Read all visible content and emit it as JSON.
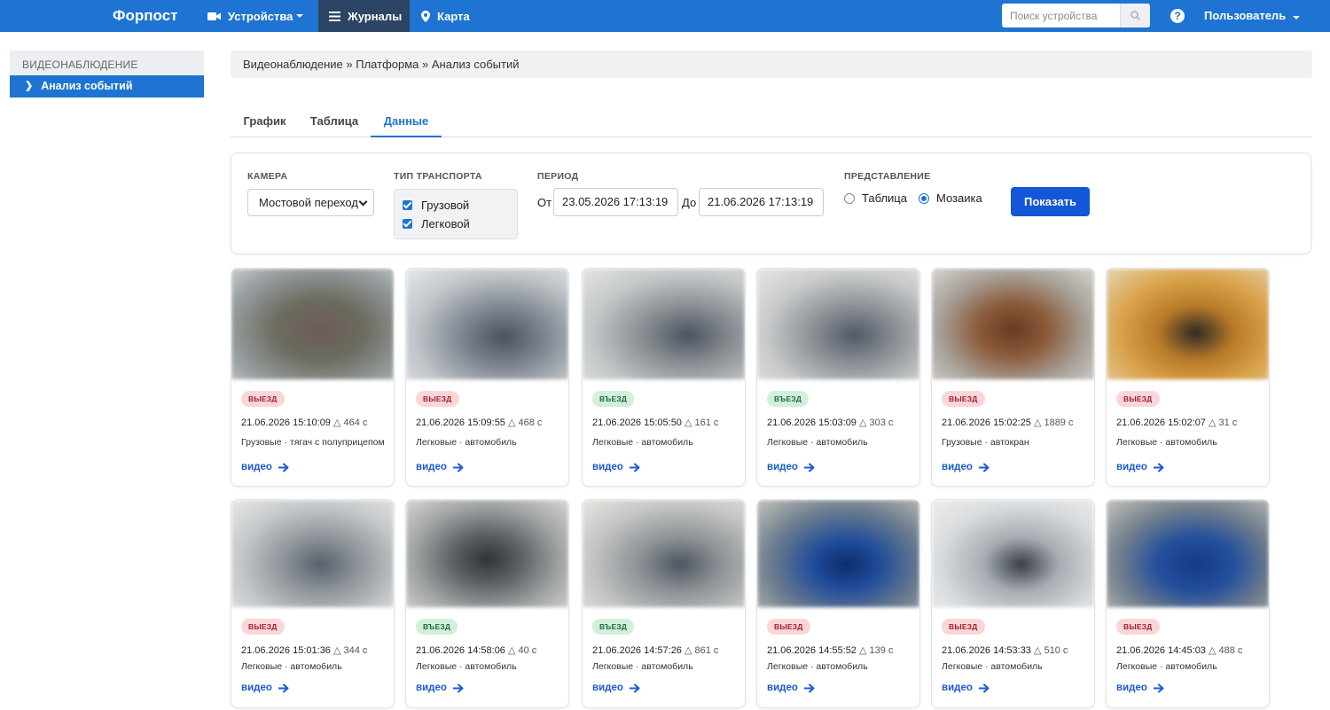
{
  "nav": {
    "brand": "Форпост",
    "devices": "Устройства",
    "journals": "Журналы",
    "map": "Карта",
    "search_placeholder": "Поиск устройства",
    "user": "Пользователь",
    "help": "?"
  },
  "sidebar": {
    "section": "ВИДЕОНАБЛЮДЕНИЕ",
    "items": [
      {
        "label": "Анализ событий"
      }
    ]
  },
  "breadcrumb": "Видеонаблюдение » Платформа » Анализ событий",
  "tabs": [
    {
      "label": "График",
      "active": false
    },
    {
      "label": "Таблица",
      "active": false
    },
    {
      "label": "Данные",
      "active": true
    }
  ],
  "filters": {
    "camera_label": "КАМЕРА",
    "camera_value": "Мостовой переход",
    "transport_label": "ТИП ТРАНСПОРТА",
    "transport_options": [
      {
        "label": "Грузовой",
        "checked": true
      },
      {
        "label": "Легковой",
        "checked": true
      }
    ],
    "period_label": "ПЕРИОД",
    "from_label": "От",
    "from_value": "23.05.2026 17:13:19",
    "to_label": "До",
    "to_value": "21.06.2026 17:13:19",
    "view_label": "ПРЕДСТАВЛЕНИЕ",
    "view_options": [
      {
        "label": "Таблица",
        "selected": false
      },
      {
        "label": "Мозаика",
        "selected": true
      }
    ],
    "show_button": "Показать"
  },
  "colors": {
    "primary": "#1f74d3",
    "nav_active": "#2c4565",
    "button": "#1356d8",
    "out_badge_bg": "#fbd6d9",
    "in_badge_bg": "#d2efdc"
  },
  "cards": [
    {
      "badge": "ВЫЕЗД",
      "type": "out",
      "time": "21.06.2026 15:10:09",
      "duration": "△ 464 с",
      "desc": "Грузовые · тягач с полуприцепом",
      "link": "видео"
    },
    {
      "badge": "ВЫЕЗД",
      "type": "out",
      "time": "21.06.2026 15:09:55",
      "duration": "△ 468 с",
      "desc": "Легковые · автомобиль",
      "link": "видео"
    },
    {
      "badge": "ВЪЕЗД",
      "type": "in",
      "time": "21.06.2026 15:05:50",
      "duration": "△ 161 с",
      "desc": "Легковые · автомобиль",
      "link": "видео"
    },
    {
      "badge": "ВЪЕЗД",
      "type": "in",
      "time": "21.06.2026 15:03:09",
      "duration": "△ 303 с",
      "desc": "Легковые · автомобиль",
      "link": "видео"
    },
    {
      "badge": "ВЫЕЗД",
      "type": "out",
      "time": "21.06.2026 15:02:25",
      "duration": "△ 1889 с",
      "desc": "Грузовые · автокран",
      "link": "видео"
    },
    {
      "badge": "ВЫЕЗД",
      "type": "out",
      "time": "21.06.2026 15:02:07",
      "duration": "△ 31 с",
      "desc": "Легковые · автомобиль",
      "link": "видео"
    },
    {
      "badge": "ВЫЕЗД",
      "type": "out",
      "time": "21.06.2026 15:01:36",
      "duration": "△ 344 с",
      "desc": "Легковые · автомобиль",
      "link": "видео"
    },
    {
      "badge": "ВЪЕЗД",
      "type": "in",
      "time": "21.06.2026 14:58:06",
      "duration": "△ 40 с",
      "desc": "Легковые · автомобиль",
      "link": "видео"
    },
    {
      "badge": "ВЪЕЗД",
      "type": "in",
      "time": "21.06.2026 14:57:26",
      "duration": "△ 861 с",
      "desc": "Легковые · автомобиль",
      "link": "видео"
    },
    {
      "badge": "ВЫЕЗД",
      "type": "out",
      "time": "21.06.2026 14:55:52",
      "duration": "△ 139 с",
      "desc": "Легковые · автомобиль",
      "link": "видео"
    },
    {
      "badge": "ВЫЕЗД",
      "type": "out",
      "time": "21.06.2026 14:53:33",
      "duration": "△ 510 с",
      "desc": "Легковые · автомобиль",
      "link": "видео"
    },
    {
      "badge": "ВЫЕЗД",
      "type": "out",
      "time": "21.06.2026 14:45:03",
      "duration": "△ 488 с",
      "desc": "Легковые · автомобиль",
      "link": "видео"
    }
  ]
}
